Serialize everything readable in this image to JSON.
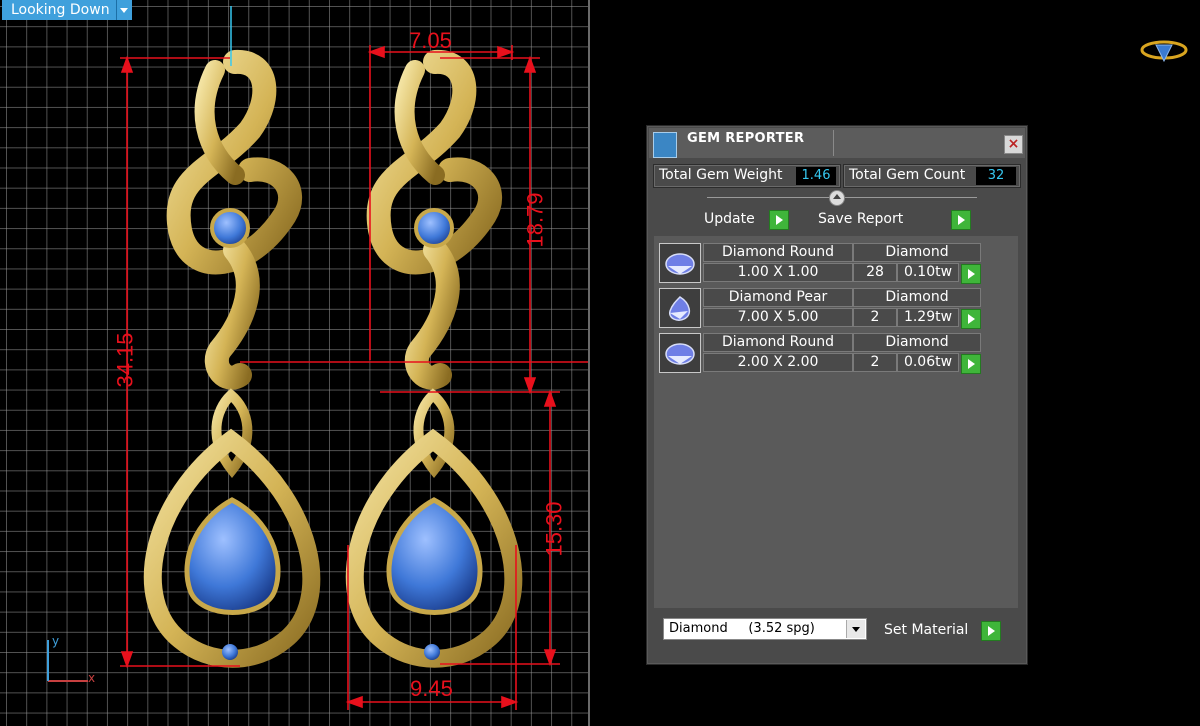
{
  "viewport": {
    "view_label": "Looking Down",
    "dimensions": {
      "top_width": "7.05",
      "upper_height": "18.79",
      "total_height": "34.15",
      "lower_height": "15.30",
      "bottom_width": "9.45"
    },
    "axes": {
      "y": "y",
      "x": "x"
    }
  },
  "gem_reporter": {
    "title": "GEM REPORTER",
    "close": "×",
    "total_weight_label": "Total Gem Weight",
    "total_weight_value": "1.46",
    "total_count_label": "Total Gem Count",
    "total_count_value": "32",
    "update_label": "Update",
    "save_report_label": "Save Report",
    "gems": [
      {
        "shape": "Diamond Round",
        "material": "Diamond",
        "size": "1.00 X 1.00",
        "count": "28",
        "weight": "0.10tw"
      },
      {
        "shape": "Diamond Pear",
        "material": "Diamond",
        "size": "7.00 X 5.00",
        "count": "2",
        "weight": "1.29tw"
      },
      {
        "shape": "Diamond Round",
        "material": "Diamond",
        "size": "2.00 X 2.00",
        "count": "2",
        "weight": "0.06tw"
      }
    ],
    "material_select": "Diamond     (3.52 spg)",
    "set_material_label": "Set Material"
  },
  "colors": {
    "accent": "#3fa0dc",
    "dimension_red": "#e8101c",
    "play_green": "#3fb53a",
    "gold": "#d9c06a",
    "gem_blue": "#3f78d8"
  }
}
